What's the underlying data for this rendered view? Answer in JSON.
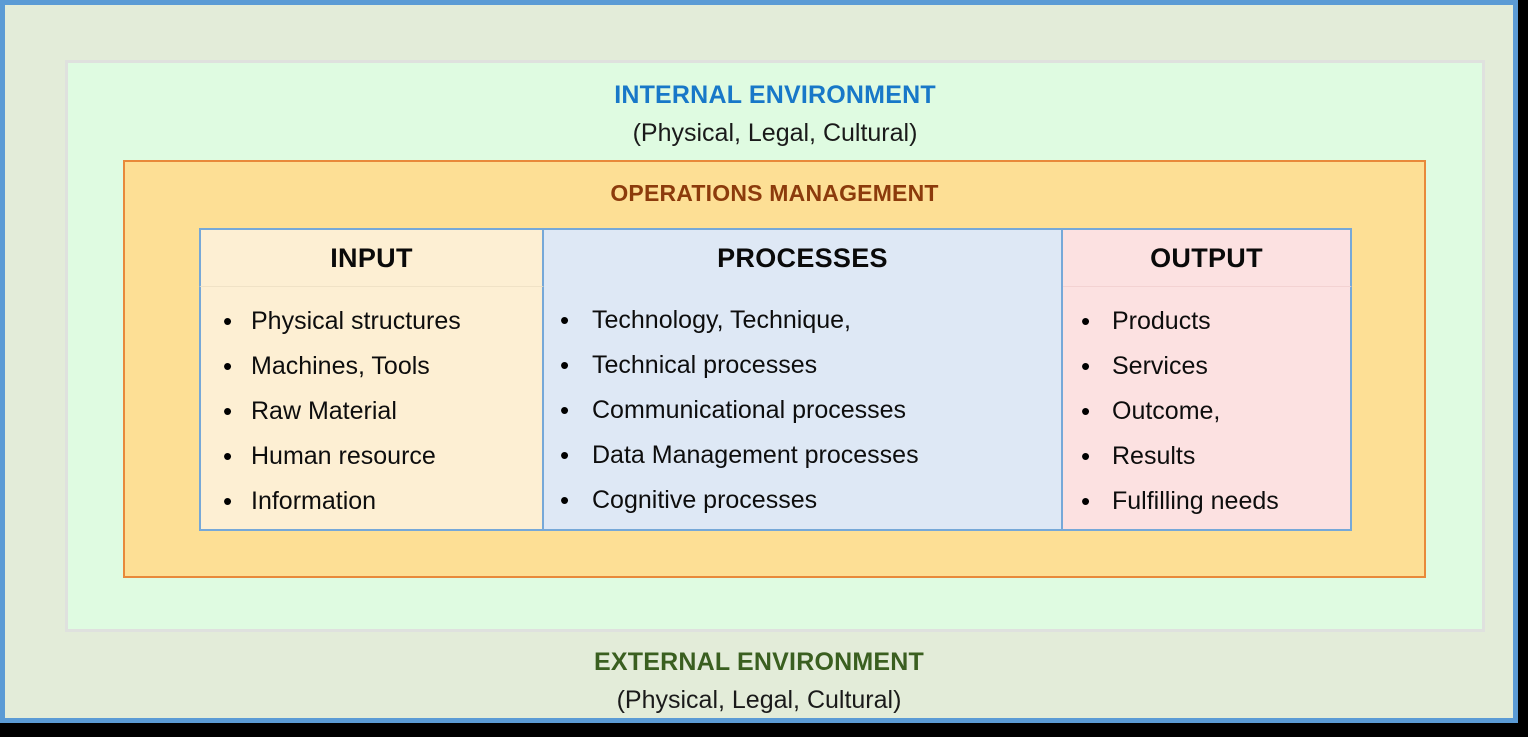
{
  "diagram": {
    "external_environment": {
      "title": "EXTERNAL ENVIRONMENT",
      "subtitle": "(Physical, Legal, Cultural)",
      "title_color": "#3A5F20",
      "background_color": "#E3ECD9",
      "border_color": "#5B9BD5"
    },
    "internal_environment": {
      "title": "INTERNAL ENVIRONMENT",
      "subtitle": "(Physical, Legal, Cultural)",
      "title_color": "#1878C8",
      "background_color": "#DFFBE1",
      "border_color": "#DFE1DE"
    },
    "operations_management": {
      "title": "OPERATIONS MANAGEMENT",
      "title_color": "#8C3B0C",
      "background_color": "#FDDF95",
      "border_color": "#E8893A"
    },
    "columns": [
      {
        "header": "INPUT",
        "background_color": "#FDEFD3",
        "items": [
          "Physical structures",
          "Machines, Tools",
          "Raw Material",
          "Human resource",
          "Information"
        ]
      },
      {
        "header": "PROCESSES",
        "background_color": "#DEE8F5",
        "items": [
          "Technology, Technique,",
          "Technical processes",
          "Communicational processes",
          "Data Management processes",
          "Cognitive processes"
        ]
      },
      {
        "header": "OUTPUT",
        "background_color": "#FCE1E1",
        "items": [
          "Products",
          "Services",
          "Outcome,",
          "Results",
          "Fulfilling needs"
        ]
      }
    ]
  }
}
